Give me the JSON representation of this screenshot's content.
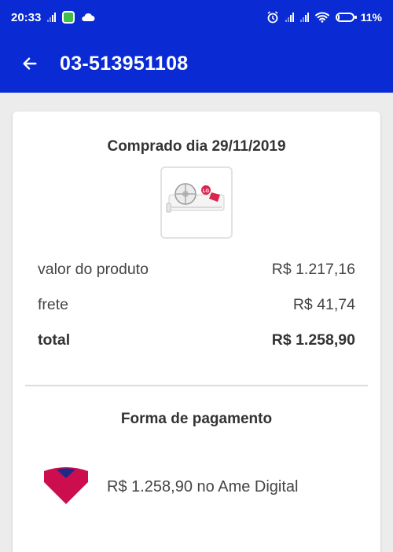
{
  "status_bar": {
    "time": "20:33",
    "battery": "11%",
    "battery_level": 0.11
  },
  "header": {
    "title": "03-513951108"
  },
  "order": {
    "purchased_label": "Comprado dia 29/11/2019",
    "rows": [
      {
        "label": "valor do produto",
        "value": "R$ 1.217,16"
      },
      {
        "label": "frete",
        "value": "R$ 41,74"
      },
      {
        "label": "total",
        "value": "R$ 1.258,90"
      }
    ]
  },
  "payment": {
    "title": "Forma de pagamento",
    "method_text": "R$ 1.258,90 no Ame Digital"
  },
  "colors": {
    "brand_blue": "#0a2bd3",
    "ame_red": "#cc0d4e",
    "ame_navy": "#1e2a8a"
  }
}
